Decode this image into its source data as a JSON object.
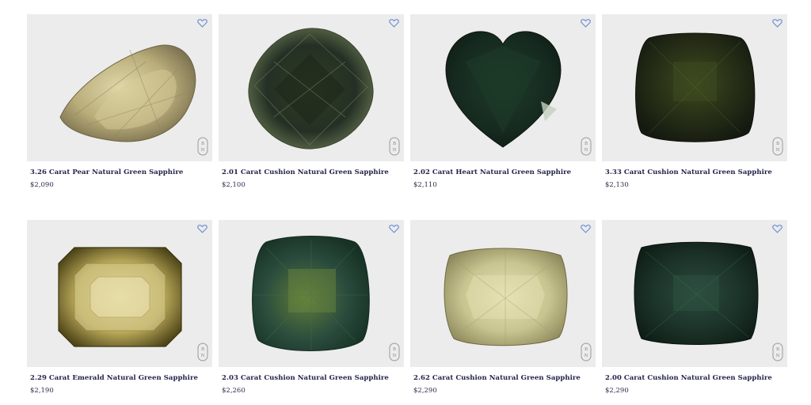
{
  "products": [
    {
      "title": "3.26 Carat Pear Natural Green Sapphire",
      "price": "$2,090"
    },
    {
      "title": "2.01 Carat Cushion Natural Green Sapphire",
      "price": "$2,100"
    },
    {
      "title": "2.02 Carat Heart Natural Green Sapphire",
      "price": "$2,110"
    },
    {
      "title": "3.33 Carat Cushion Natural Green Sapphire",
      "price": "$2,130"
    },
    {
      "title": "2.29 Carat Emerald Natural Green Sapphire",
      "price": "$2,190"
    },
    {
      "title": "2.03 Carat Cushion Natural Green Sapphire",
      "price": "$2,260"
    },
    {
      "title": "2.62 Carat Cushion Natural Green Sapphire",
      "price": "$2,290"
    },
    {
      "title": "2.00 Carat Cushion Natural Green Sapphire",
      "price": "$2,290"
    }
  ],
  "badge_text": [
    "B",
    "N"
  ],
  "icons": {
    "favorite": "heart-outline-icon",
    "brand_badge": "bn-badge-icon"
  },
  "colors": {
    "heart": "#6c8fd6",
    "title": "#23234a",
    "photo_bg": "#ececec"
  }
}
